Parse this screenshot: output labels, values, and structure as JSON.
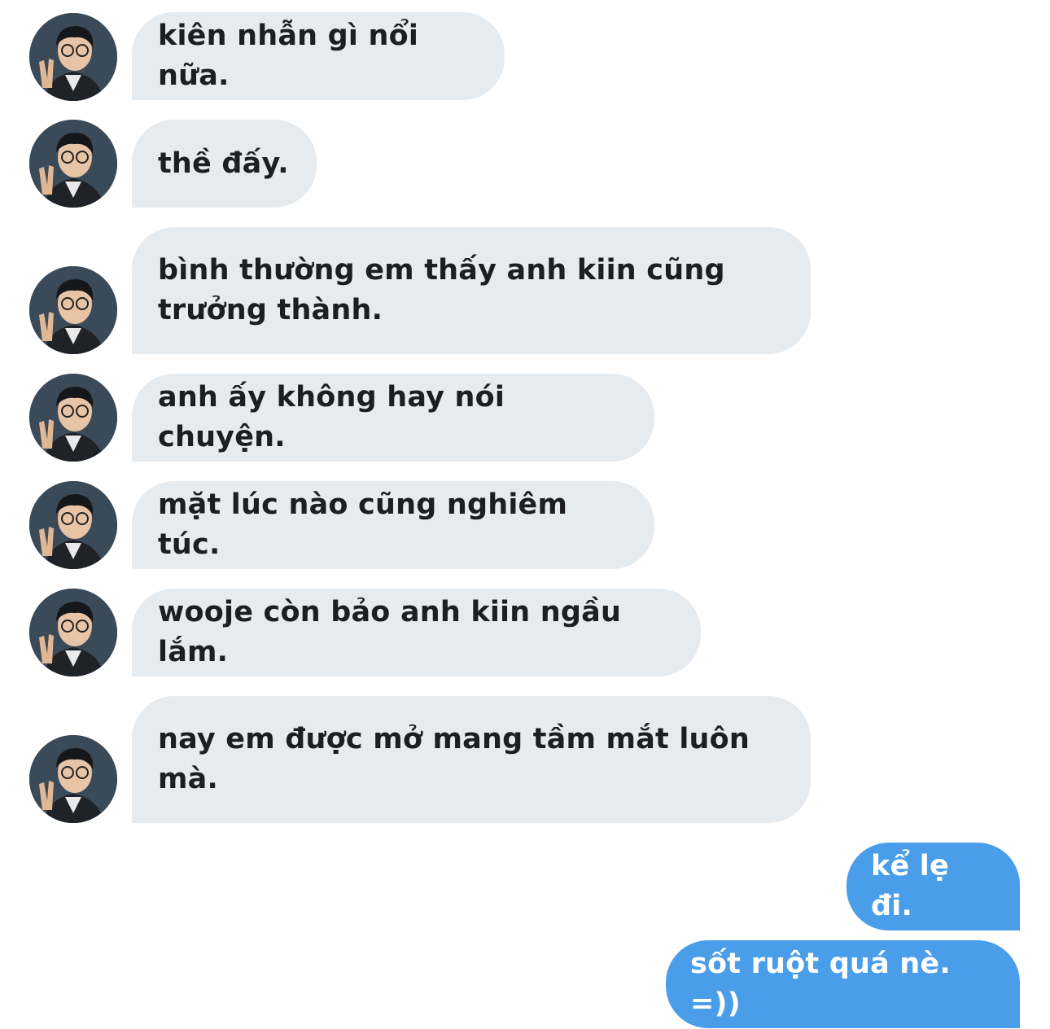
{
  "conversation": {
    "incoming": [
      {
        "text": "kiên nhẫn gì nổi nữa."
      },
      {
        "text": "thề đấy."
      },
      {
        "text": "bình thường em thấy anh kiin cũng trưởng thành."
      },
      {
        "text": "anh ấy không hay nói chuyện."
      },
      {
        "text": "mặt lúc nào cũng nghiêm túc."
      },
      {
        "text": "wooje còn bảo anh kiin ngầu lắm."
      },
      {
        "text": "nay em được mở mang tầm mắt luôn mà."
      }
    ],
    "outgoing": [
      {
        "text": "kể lẹ đi."
      },
      {
        "text": "sốt ruột quá nè. =))"
      }
    ]
  },
  "colors": {
    "incoming_bubble": "#e6ebf0",
    "outgoing_bubble": "#4a9ee9",
    "incoming_text": "#1c1e21",
    "outgoing_text": "#ffffff"
  },
  "icons": {
    "avatar": "user-avatar-photo"
  }
}
